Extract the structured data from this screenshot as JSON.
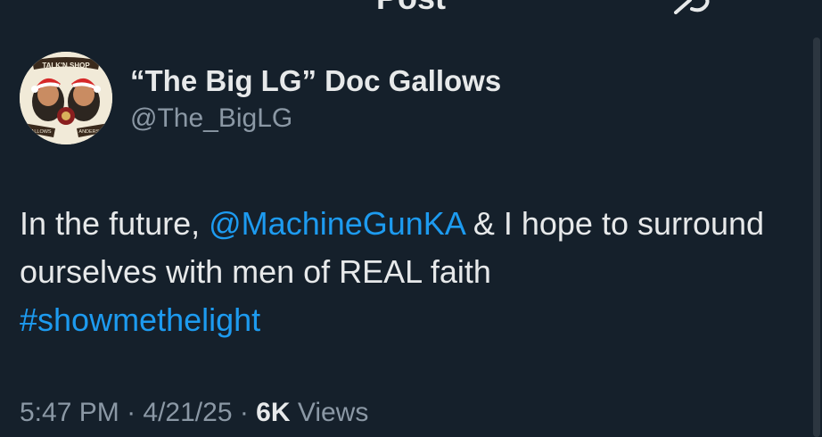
{
  "header": {
    "title": "Post",
    "back_icon": "back-arrow-icon",
    "grok_icon": "grok-icon"
  },
  "author": {
    "name": "“The Big LG” Doc Gallows",
    "handle": "@The_BigLG",
    "avatar_text_top": "TALK'N SHOP",
    "avatar_text_left": "GALLOWS",
    "avatar_text_right": "ANDERSON"
  },
  "tweet": {
    "part1": "In the future, ",
    "mention": "@MachineGunKA",
    "part2": " & I hope to surround ourselves with men of REAL faith",
    "hashtag": "#showmethelight"
  },
  "meta": {
    "time": "5:47 PM",
    "sep1": " · ",
    "date": "4/21/25",
    "sep2": " · ",
    "views_count": "6K",
    "views_label": " Views"
  },
  "colors": {
    "background": "#15202b",
    "text": "#e7e9ea",
    "secondary": "#8b98a5",
    "link": "#1d9bf0"
  }
}
